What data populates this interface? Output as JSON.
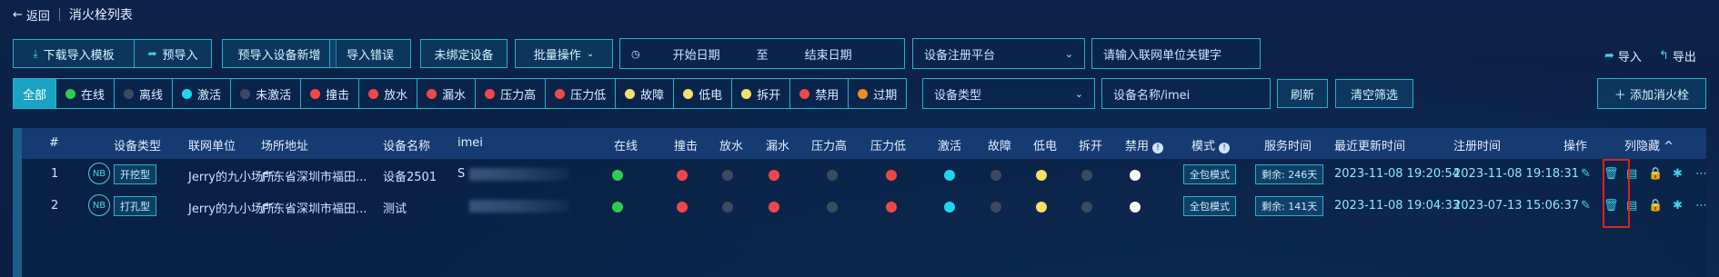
{
  "header": {
    "back": "返回",
    "title": "消火栓列表"
  },
  "toolbar": {
    "download": "下载导入模板",
    "preimport": "预导入",
    "preimport_new": "预导入设备新增",
    "import_error": "导入错误",
    "unbound": "未绑定设备",
    "batch": "批量操作",
    "start_date": "开始日期",
    "to": "至",
    "end_date": "结束日期",
    "platform": "设备注册平台",
    "unit_placeholder": "请输入联网单位关键字",
    "import": "导入",
    "export": "导出"
  },
  "filters": [
    {
      "label": "全部",
      "color": ""
    },
    {
      "label": "在线",
      "color": "#2ecc50"
    },
    {
      "label": "离线",
      "color": "#3c4a5e"
    },
    {
      "label": "激活",
      "color": "#1fd6f0"
    },
    {
      "label": "未激活",
      "color": "#3c4a5e"
    },
    {
      "label": "撞击",
      "color": "#f04848"
    },
    {
      "label": "放水",
      "color": "#f04848"
    },
    {
      "label": "漏水",
      "color": "#f04848"
    },
    {
      "label": "压力高",
      "color": "#f04848"
    },
    {
      "label": "压力低",
      "color": "#f04848"
    },
    {
      "label": "故障",
      "color": "#f5e06a"
    },
    {
      "label": "低电",
      "color": "#f5e06a"
    },
    {
      "label": "拆开",
      "color": "#f5e06a"
    },
    {
      "label": "禁用",
      "color": "#f04848"
    },
    {
      "label": "过期",
      "color": "#f08c1e"
    }
  ],
  "filter_row2": {
    "device_type": "设备类型",
    "device_search": "设备名称/imei",
    "refresh": "刷新",
    "clear": "清空筛选",
    "add": "＋ 添加消火栓"
  },
  "table": {
    "headers": {
      "num": "#",
      "type": "设备类型",
      "unit": "联网单位",
      "addr": "场所地址",
      "name": "设备名称",
      "imei": "imei",
      "online": "在线",
      "impact": "撞击",
      "release": "放水",
      "leak": "漏水",
      "phigh": "压力高",
      "plow": "压力低",
      "active": "激活",
      "fault": "故障",
      "lowbat": "低电",
      "open": "拆开",
      "disabled": "禁用",
      "mode": "模式",
      "service": "服务时间",
      "updated": "最近更新时间",
      "registered": "注册时间",
      "ops": "操作",
      "hide": "列隐藏 ^"
    },
    "rows": [
      {
        "num": "1",
        "nb": "NB",
        "type": "开挖型",
        "unit": "Jerry的九小场所",
        "addr": "广东省深圳市福田...",
        "name": "设备2501",
        "imei_prefix": "S",
        "mode": "全包模式",
        "service": "剩余: 246天",
        "updated": "2023-11-08 19:20:54",
        "registered": "2023-11-08 19:18:31"
      },
      {
        "num": "2",
        "nb": "NB",
        "type": "打孔型",
        "unit": "Jerry的九小场所",
        "addr": "广东省深圳市福田...",
        "name": "测试",
        "imei_prefix": "",
        "mode": "全包模式",
        "service": "剩余: 141天",
        "updated": "2023-11-08 19:04:33",
        "registered": "2023-07-13 15:06:37"
      }
    ]
  }
}
